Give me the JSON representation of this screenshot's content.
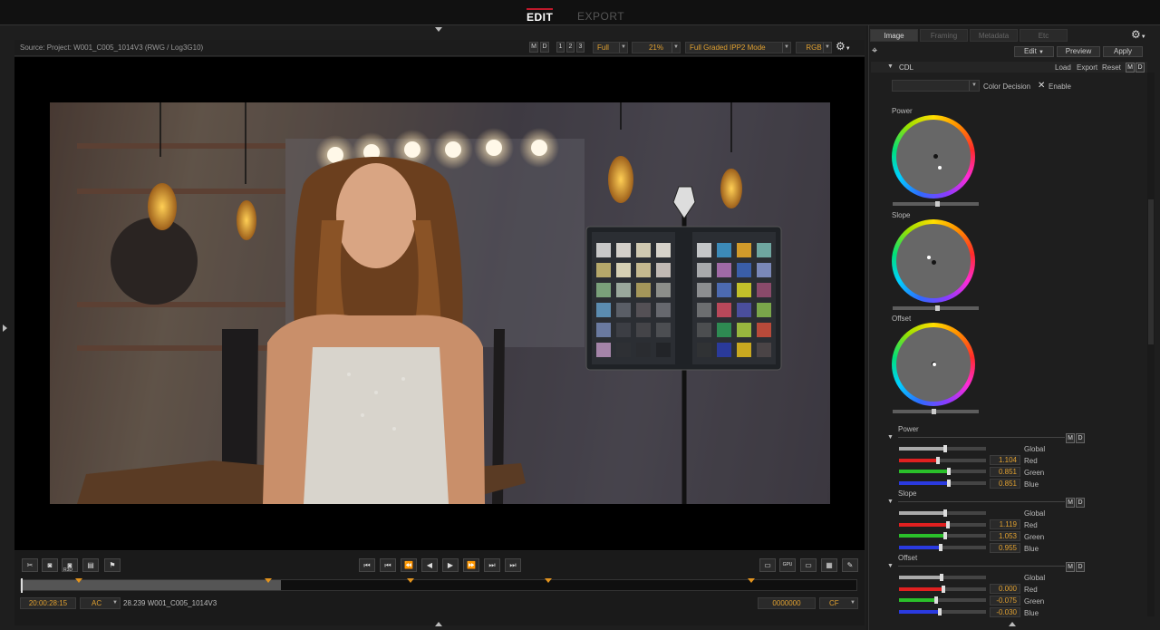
{
  "modes": {
    "edit": "EDIT",
    "export": "EXPORT"
  },
  "source": {
    "label": "Source: Project: W001_C005_1014V3   (RWG / Log3G10)",
    "m": "M",
    "d": "D",
    "p1": "1",
    "p2": "2",
    "p3": "3",
    "full": "Full",
    "zoom": "21%",
    "mode": "Full Graded IPP2 Mode",
    "channel": "RGB"
  },
  "panel": {
    "tabs": [
      "Image",
      "Framing",
      "Metadata",
      "Etc"
    ],
    "edit": "Edit",
    "preview": "Preview",
    "apply": "Apply",
    "cdl": "CDL",
    "load": "Load",
    "export": "Export",
    "reset": "Reset",
    "color_decision": "Color Decision",
    "enable": "Enable",
    "wheels": {
      "power": "Power",
      "slope": "Slope",
      "offset": "Offset"
    },
    "power": {
      "title": "Power",
      "global": "Global",
      "red": "1.104",
      "green": "0.851",
      "blue": "0.851"
    },
    "slope": {
      "title": "Slope",
      "global": "Global",
      "red": "1.119",
      "green": "1.053",
      "blue": "0.955"
    },
    "offset": {
      "title": "Offset",
      "global": "Global",
      "red": "0.000",
      "green": "-0.075",
      "blue": "-0.030"
    },
    "labels": {
      "red": "Red",
      "green": "Green",
      "blue": "Blue"
    }
  },
  "transport": {
    "rsd": "R3D",
    "timecode": "20:00:28:15",
    "ac": "AC",
    "clip": "28.239 W001_C005_1014V3",
    "frame": "0000000",
    "cf": "CF",
    "gpu": "GPU"
  },
  "colors": {
    "accent": "#e0a030",
    "edit_underline": "#c0192b"
  }
}
